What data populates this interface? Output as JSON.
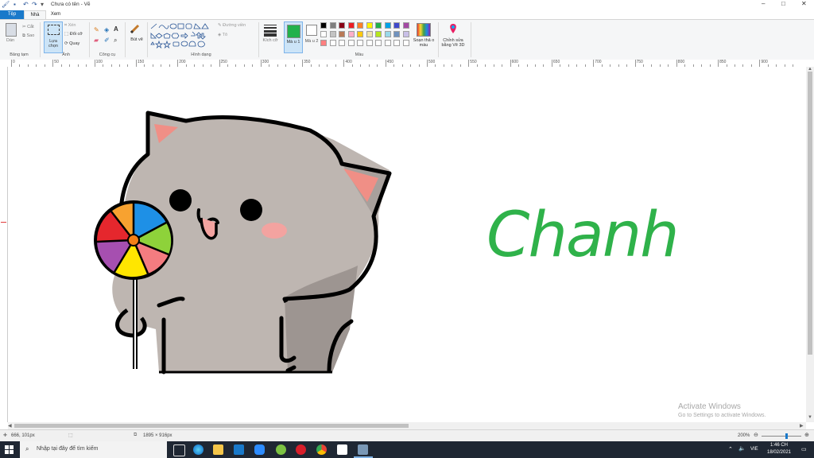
{
  "window": {
    "title": "Chưa có tên - Vẽ",
    "controls": [
      "–",
      "□",
      "✕"
    ]
  },
  "tabs": [
    {
      "label": "Tệp"
    },
    {
      "label": "Nhà"
    },
    {
      "label": "Xem"
    }
  ],
  "ribbon": {
    "clipboard": {
      "paste": "Dán",
      "cut": "Cắt",
      "copy": "Sao",
      "group": "Bảng tạm"
    },
    "image": {
      "select": "Lựa chọn",
      "crop": "Xén",
      "resize": "Đổi cỡ",
      "rotate": "Quay",
      "group": "Ảnh"
    },
    "tools": {
      "group": "Công cụ"
    },
    "brushes": {
      "label": "Bút vẽ"
    },
    "shapes": {
      "outline": "Đường viền",
      "fill": "Tô",
      "group": "Hình dạng"
    },
    "size": {
      "label": "Kích cỡ"
    },
    "color1": {
      "label": "Mà u 1"
    },
    "color2": {
      "label": "Mà u 2"
    },
    "colors_group": "Màu",
    "edit_colors": "Soạn thả o màu",
    "paint3d": "Chỉnh sửa bằng Vẽ 3D"
  },
  "palette": {
    "row1": [
      "#000000",
      "#7f7f7f",
      "#880015",
      "#ed1c24",
      "#ff7f27",
      "#fff200",
      "#22b14c",
      "#00a2e8",
      "#3f48cc",
      "#a349a4"
    ],
    "row2": [
      "#ffffff",
      "#c3c3c3",
      "#b97a57",
      "#ffaec9",
      "#ffc90e",
      "#efe4b0",
      "#b5e61d",
      "#99d9ea",
      "#7092be",
      "#c8bfe7"
    ],
    "row3": [
      "#ff7f7f",
      "#ffffff",
      "#ffffff",
      "#ffffff",
      "#ffffff",
      "#ffffff",
      "#ffffff",
      "#ffffff",
      "#ffffff",
      "#ffffff"
    ],
    "color1": "#22b14c",
    "color2": "#ffffff"
  },
  "ruler": {
    "labels": [
      "0",
      "50",
      "100",
      "150",
      "200",
      "250",
      "300",
      "350",
      "400",
      "450",
      "500",
      "550",
      "600",
      "650",
      "700",
      "750",
      "800",
      "850",
      "900"
    ]
  },
  "canvas": {
    "handwriting": "Chanh"
  },
  "status": {
    "cursor": "666, 101px",
    "size": "1895 × 916px",
    "zoom": "200%"
  },
  "watermark": {
    "line1": "Activate Windows",
    "line2": "Go to Settings to activate Windows."
  },
  "taskbar": {
    "search_placeholder": "Nhập tại đây để tìm kiếm",
    "time": "1:46 CH",
    "date": "18/02/2021",
    "lang": "VIE"
  }
}
